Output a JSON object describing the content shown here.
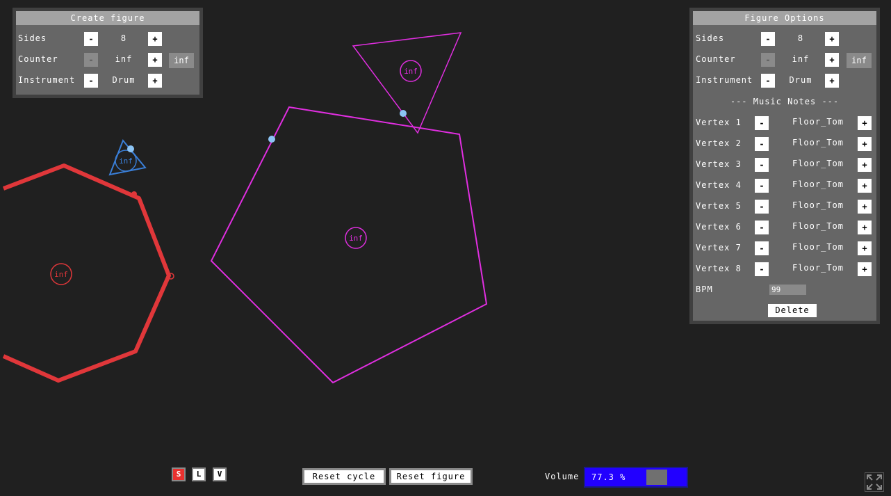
{
  "create_panel": {
    "title": "Create figure",
    "rows": [
      {
        "label": "Sides",
        "minus": "-",
        "value": "8",
        "plus": "+"
      },
      {
        "label": "Counter",
        "minus": "-",
        "value": "inf",
        "plus": "+",
        "extra": "inf"
      },
      {
        "label": "Instrument",
        "minus": "-",
        "value": "Drum",
        "plus": "+"
      }
    ]
  },
  "options_panel": {
    "title": "Figure Options",
    "rows": [
      {
        "label": "Sides",
        "minus": "-",
        "value": "8",
        "plus": "+"
      },
      {
        "label": "Counter",
        "minus": "-",
        "value": "inf",
        "plus": "+",
        "extra": "inf"
      },
      {
        "label": "Instrument",
        "minus": "-",
        "value": "Drum",
        "plus": "+"
      }
    ],
    "music_notes_header": "--- Music Notes ---",
    "vertices": [
      {
        "label": "Vertex 1",
        "note": "Floor_Tom"
      },
      {
        "label": "Vertex 2",
        "note": "Floor_Tom"
      },
      {
        "label": "Vertex 3",
        "note": "Floor_Tom"
      },
      {
        "label": "Vertex 4",
        "note": "Floor_Tom"
      },
      {
        "label": "Vertex 5",
        "note": "Floor_Tom"
      },
      {
        "label": "Vertex 6",
        "note": "Floor_Tom"
      },
      {
        "label": "Vertex 7",
        "note": "Floor_Tom"
      },
      {
        "label": "Vertex 8",
        "note": "Floor_Tom"
      }
    ],
    "minus": "-",
    "plus": "+",
    "bpm_label": "BPM",
    "bpm_value": "99",
    "delete_label": "Delete"
  },
  "figures": {
    "label": "inf",
    "colors": {
      "red": "#e0373a",
      "magenta": "#e02ee0",
      "blue": "#3a7fd8",
      "dot": "#8cc4f5"
    }
  },
  "bottom_bar": {
    "modes": [
      {
        "label": "S",
        "active": true
      },
      {
        "label": "L",
        "active": false
      },
      {
        "label": "V",
        "active": false
      }
    ],
    "reset_cycle": "Reset cycle",
    "reset_figure": "Reset figure",
    "volume_label": "Volume",
    "volume_text": "77.3 %",
    "volume_percent": 77.3,
    "volume_color": "#2200ff"
  }
}
